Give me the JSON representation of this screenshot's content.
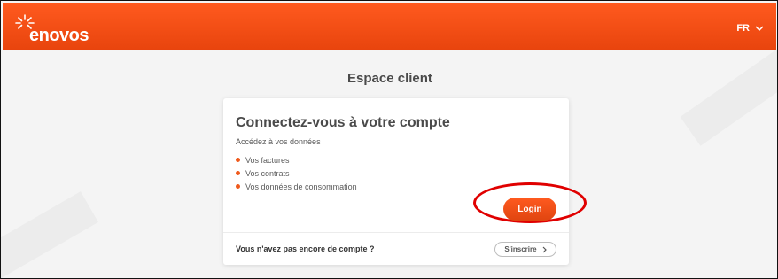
{
  "header": {
    "brand": "enovos",
    "language": "FR"
  },
  "page": {
    "title": "Espace client"
  },
  "card": {
    "title": "Connectez-vous à votre compte",
    "subtitle": "Accédez à vos données",
    "bullets": [
      "Vos factures",
      "Vos contrats",
      "Vos données de consommation"
    ],
    "login_label": "Login",
    "no_account_text": "Vous n'avez pas encore de compte ?",
    "signup_label": "S'inscrire"
  },
  "colors": {
    "brand_orange": "#ef5a1d",
    "annotation_red": "#e00000"
  }
}
